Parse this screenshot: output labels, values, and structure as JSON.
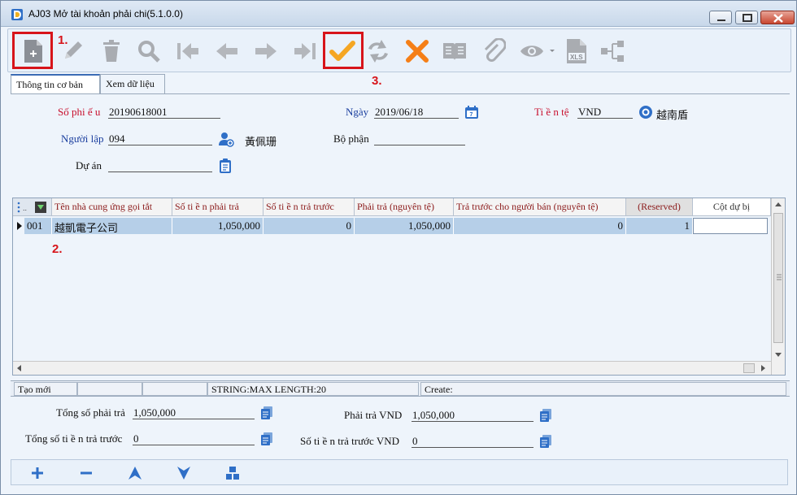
{
  "window": {
    "title": "AJ03 Mở tài khoản phải chi(5.1.0.0)"
  },
  "annotations": {
    "a1": "1.",
    "a2": "2.",
    "a3": "3."
  },
  "toolbar": {
    "icons": [
      "new-document-icon",
      "edit-pencil-icon",
      "delete-trash-icon",
      "search-icon",
      "first-record-icon",
      "previous-record-icon",
      "next-record-icon",
      "last-record-icon",
      "confirm-check-icon",
      "refresh-icon",
      "cancel-x-icon",
      "book-icon",
      "attachment-icon",
      "view-eye-icon",
      "export-xls-icon",
      "tree-icon"
    ]
  },
  "tabs": {
    "basic": "Thông tin cơ bản",
    "view": "Xem dữ liệu"
  },
  "form": {
    "voucher_no_label": "Số phi ế u",
    "voucher_no": "20190618001",
    "date_label": "Ngày",
    "date": "2019/06/18",
    "currency_label": "Ti ề n tệ",
    "currency": "VND",
    "currency_name": "越南盾",
    "creator_label": "Người lập",
    "creator": "094",
    "creator_name": "黃佩珊",
    "department_label": "Bộ phận",
    "department": "",
    "project_label": "Dự án",
    "project": ""
  },
  "grid": {
    "columns": [
      "Tên nhà cung ứng gọi tắt",
      "Số ti ề n phải trả",
      "Số ti ề n trả trước",
      "Phải trả (nguyên tệ)",
      "Trả trước cho người bán (nguyên tệ)",
      "(Reserved)",
      "Cột dự bị"
    ],
    "rows": [
      {
        "no": "001",
        "vendor": "越凱電子公司",
        "payable": "1,050,000",
        "prepaid": "0",
        "payable_orig": "1,050,000",
        "prepaid_orig": "0",
        "reserved": "1",
        "spare": ""
      }
    ]
  },
  "statusbar": {
    "mode": "Tạo mới",
    "field_info": "STRING:MAX LENGTH:20",
    "create_label": "Create:"
  },
  "totals": {
    "total_payable_label": "Tổng số phải trả",
    "total_payable": "1,050,000",
    "total_prepaid_label": "Tổng số ti ề n trả trước",
    "total_prepaid": "0",
    "payable_vnd_label": "Phải trả VND",
    "payable_vnd": "1,050,000",
    "prepaid_vnd_label": "Số ti ề n trả trước VND",
    "prepaid_vnd": "0"
  },
  "colors": {
    "accent_red": "#d7141a",
    "label_red": "#c8102e",
    "label_blue": "#1a3e9e",
    "icon_blue": "#2f6fc7",
    "confirm_orange": "#f5a623"
  }
}
